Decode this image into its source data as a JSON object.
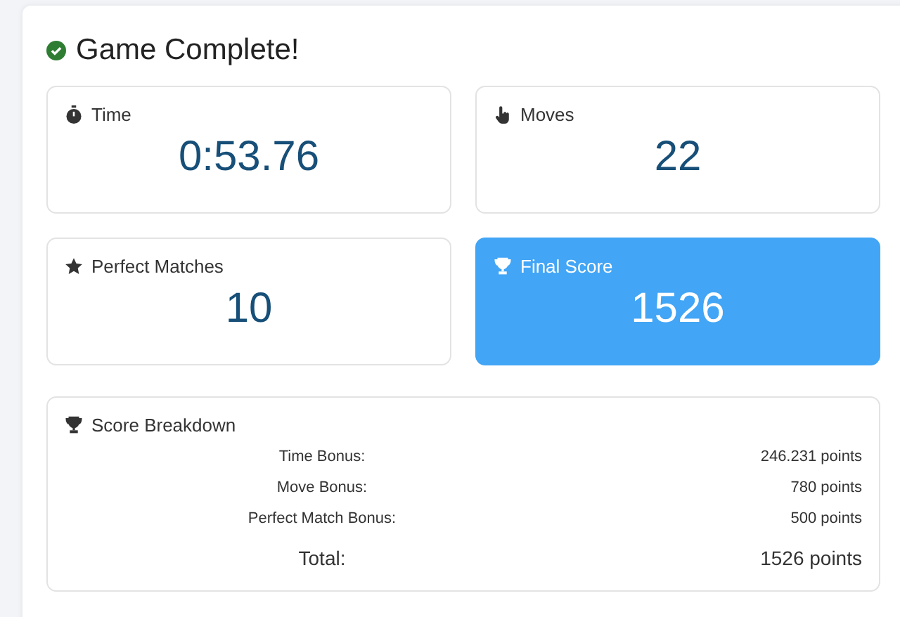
{
  "title": "Game Complete!",
  "stats": [
    {
      "kind": "time",
      "label": "Time",
      "value": "0:53.76",
      "highlighted": false
    },
    {
      "kind": "moves",
      "label": "Moves",
      "value": "22",
      "highlighted": false
    },
    {
      "kind": "matches",
      "label": "Perfect Matches",
      "value": "10",
      "highlighted": false
    },
    {
      "kind": "score",
      "label": "Final Score",
      "value": "1526",
      "highlighted": true
    }
  ],
  "breakdown": {
    "title": "Score Breakdown",
    "rows": [
      {
        "label": "Time Bonus:",
        "value": "246.231 points",
        "total": false
      },
      {
        "label": "Move Bonus:",
        "value": "780 points",
        "total": false
      },
      {
        "label": "Perfect Match Bonus:",
        "value": "500 points",
        "total": false
      },
      {
        "label": "Total:",
        "value": "1526 points",
        "total": true
      }
    ]
  }
}
